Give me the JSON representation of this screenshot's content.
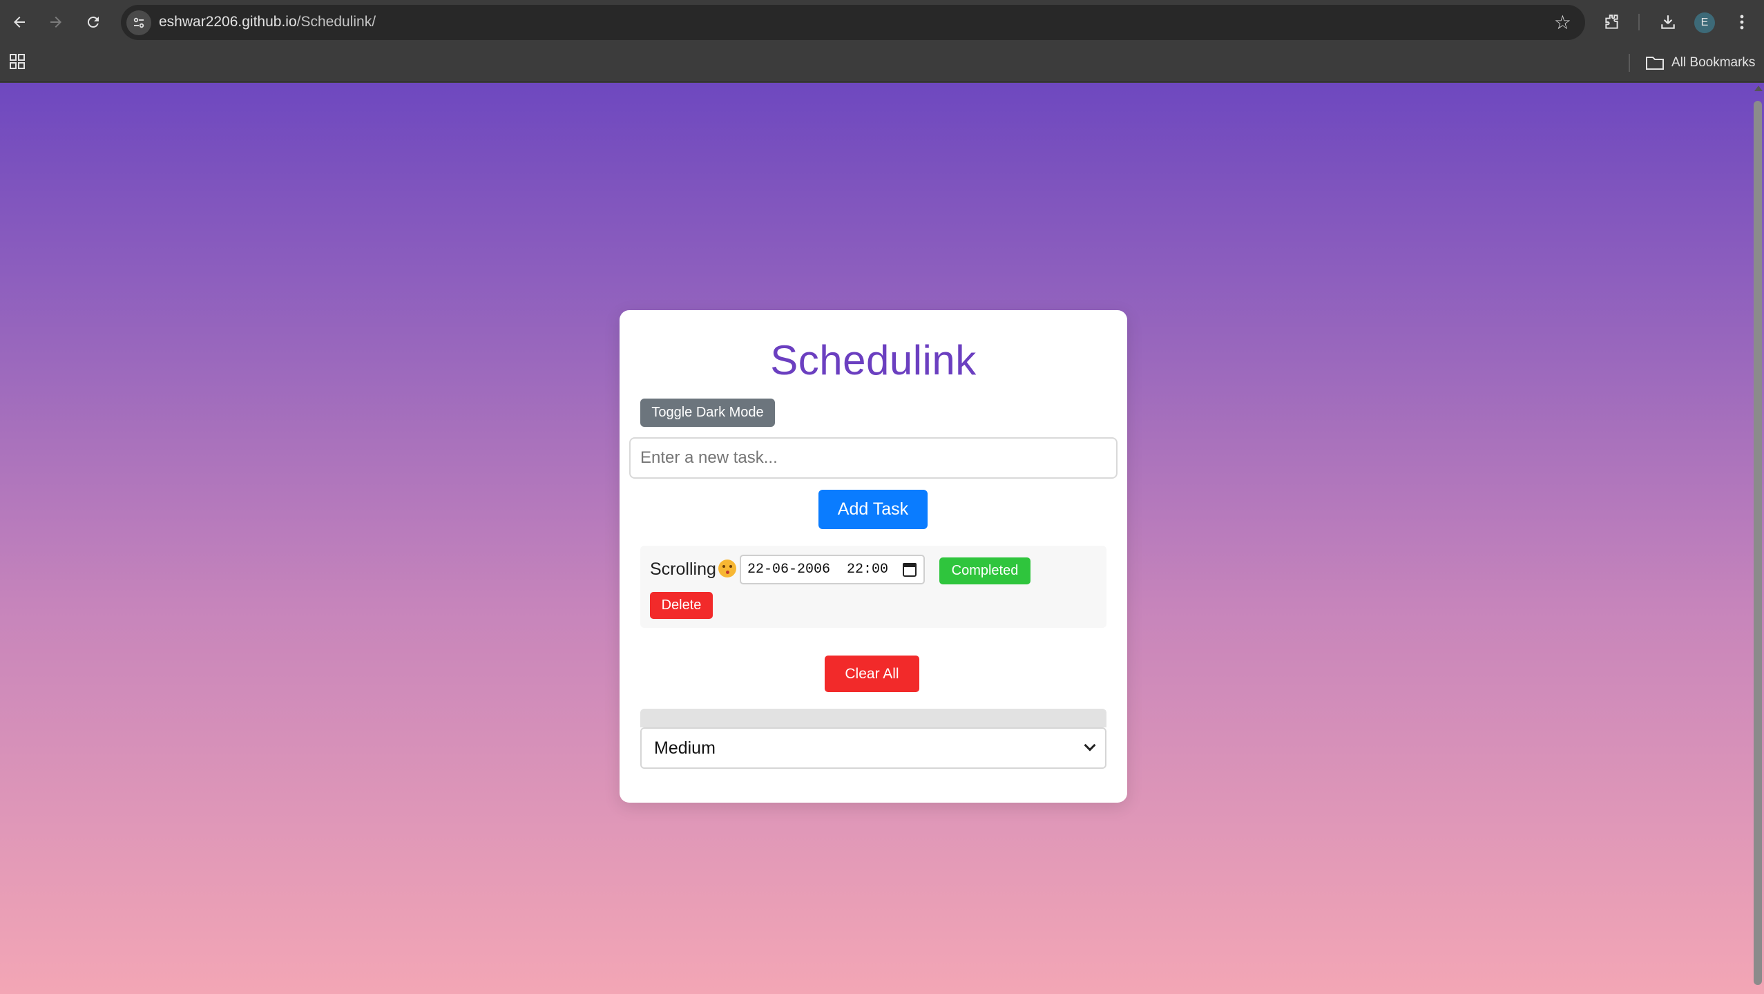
{
  "browser": {
    "url_host": "eshwar2206.github.io",
    "url_path": "/Schedulink/",
    "profile_initial": "E",
    "bookmarks_label": "All Bookmarks",
    "icons": [
      "back-icon",
      "forward-icon",
      "reload-icon",
      "site-info-icon",
      "star-icon",
      "extensions-icon",
      "download-icon",
      "menu-icon",
      "apps-icon",
      "folder-icon"
    ]
  },
  "app": {
    "title": "Schedulink",
    "toggle_dark_mode": "Toggle Dark Mode",
    "task_input": {
      "placeholder": "Enter a new task...",
      "value": ""
    },
    "add_task": "Add Task",
    "tasks": [
      {
        "text": "Scrolling",
        "emoji": "kissing-face-icon",
        "datetime": "22-06-2006  22:00",
        "completed_label": "Completed",
        "delete_label": "Delete"
      }
    ],
    "clear_all": "Clear All",
    "progress_fraction": 0,
    "priority": {
      "selected": "Medium"
    }
  },
  "colors": {
    "gradient_top": "#6e48bf",
    "gradient_bottom": "#f3a6b5",
    "title": "#6b3fc0",
    "add_button": "#0a7cff",
    "completed_button": "#2fc53d",
    "danger_button": "#f22a2a",
    "toggle_button": "#6c757d"
  }
}
